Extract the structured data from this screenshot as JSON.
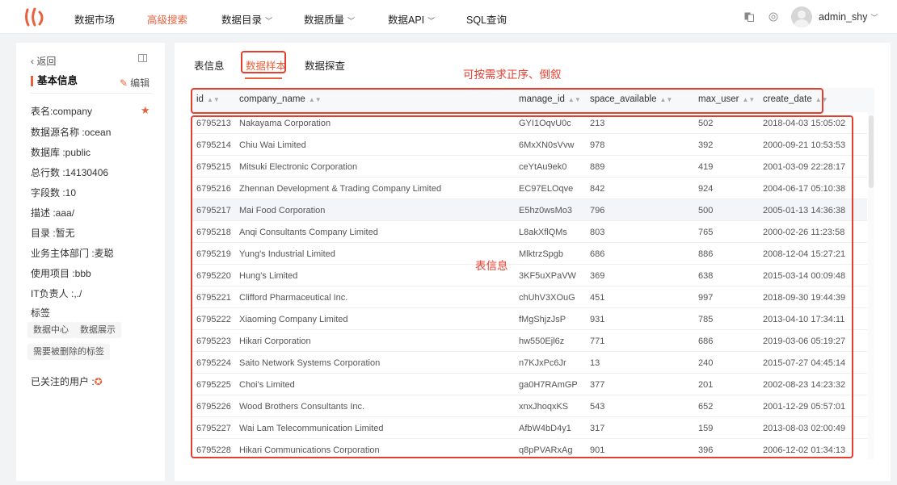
{
  "nav": {
    "items": [
      {
        "label": "数据市场",
        "dropdown": false,
        "active": false
      },
      {
        "label": "高级搜索",
        "dropdown": false,
        "active": true
      },
      {
        "label": "数据目录",
        "dropdown": true,
        "active": false
      },
      {
        "label": "数据质量",
        "dropdown": true,
        "active": false
      },
      {
        "label": "数据API",
        "dropdown": true,
        "active": false
      },
      {
        "label": "SQL查询",
        "dropdown": false,
        "active": false
      }
    ],
    "username": "admin_shy",
    "accent_color": "#e8603c"
  },
  "sidebar": {
    "back_label": "返回",
    "title": "基本信息",
    "edit_label": "编辑",
    "info": [
      "表名:company",
      "数据源名称 :ocean",
      "数据库 :public",
      "总行数 :14130406",
      "字段数 :10",
      "描述 :aaa/",
      "目录 :暂无",
      "业务主体部门 :麦聪",
      "使用项目 :bbb",
      "IT负责人 :,./"
    ],
    "tags_label": "标签",
    "tags": [
      "数据中心",
      "数据展示",
      "需要被删除的标签"
    ],
    "followers_label": "已关注的用户 :"
  },
  "tabs": [
    {
      "label": "表信息",
      "active": false
    },
    {
      "label": "数据样本",
      "active": true
    },
    {
      "label": "数据探查",
      "active": false
    }
  ],
  "annotations": {
    "sort_hint": "可按需求正序、倒叙",
    "table_hint": "表信息"
  },
  "table": {
    "columns": [
      "id",
      "company_name",
      "manage_id",
      "space_available",
      "max_user",
      "create_date"
    ],
    "rows": [
      [
        "6795213",
        "Nakayama Corporation",
        "GYI1OqvU0c",
        "213",
        "502",
        "2018-04-03 15:05:02"
      ],
      [
        "6795214",
        "Chiu Wai Limited",
        "6MxXN0sVvw",
        "978",
        "392",
        "2000-09-21 10:53:53"
      ],
      [
        "6795215",
        "Mitsuki Electronic Corporation",
        "ceYtAu9ek0",
        "889",
        "419",
        "2001-03-09 22:28:17"
      ],
      [
        "6795216",
        "Zhennan Development & Trading Company Limited",
        "EC97ELOqve",
        "842",
        "924",
        "2004-06-17 05:10:38"
      ],
      [
        "6795217",
        "Mai Food Corporation",
        "E5hz0wsMo3",
        "796",
        "500",
        "2005-01-13 14:36:38"
      ],
      [
        "6795218",
        "Anqi Consultants Company Limited",
        "L8akXflQMs",
        "803",
        "765",
        "2000-02-26 11:23:58"
      ],
      [
        "6795219",
        "Yung's Industrial Limited",
        "MlktrzSpgb",
        "686",
        "886",
        "2008-12-04 15:27:21"
      ],
      [
        "6795220",
        "Hung's Limited",
        "3KF5uXPaVW",
        "369",
        "638",
        "2015-03-14 00:09:48"
      ],
      [
        "6795221",
        "Clifford Pharmaceutical Inc.",
        "chUhV3XOuG",
        "451",
        "997",
        "2018-09-30 19:44:39"
      ],
      [
        "6795222",
        "Xiaoming Company Limited",
        "fMgShjzJsP",
        "931",
        "785",
        "2013-04-10 17:34:11"
      ],
      [
        "6795223",
        "Hikari Corporation",
        "hw550Ejl6z",
        "771",
        "686",
        "2019-03-06 05:19:27"
      ],
      [
        "6795224",
        "Saito Network Systems Corporation",
        "n7KJxPc6Jr",
        "13",
        "240",
        "2015-07-27 04:45:14"
      ],
      [
        "6795225",
        "Choi's Limited",
        "ga0H7RAmGP",
        "377",
        "201",
        "2002-08-23 14:23:32"
      ],
      [
        "6795226",
        "Wood Brothers Consultants Inc.",
        "xnxJhoqxKS",
        "543",
        "652",
        "2001-12-29 05:57:01"
      ],
      [
        "6795227",
        "Wai Lam Telecommunication Limited",
        "AfbW4bD4y1",
        "317",
        "159",
        "2013-08-03 02:00:49"
      ],
      [
        "6795228",
        "Hikari Communications Corporation",
        "q8pPVARxAg",
        "901",
        "396",
        "2006-12-02 01:34:13"
      ]
    ]
  }
}
